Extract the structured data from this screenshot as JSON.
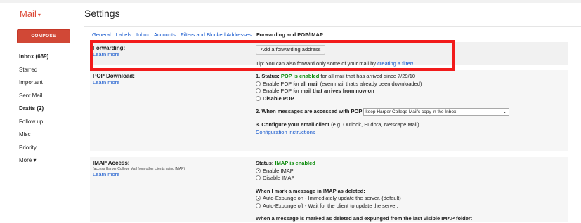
{
  "app": {
    "title": "Mail",
    "caret": "▾"
  },
  "page": {
    "title": "Settings"
  },
  "compose": {
    "label": "COMPOSE"
  },
  "sidebar": {
    "items": [
      {
        "label": "Inbox (669)"
      },
      {
        "label": "Starred"
      },
      {
        "label": "Important"
      },
      {
        "label": "Sent Mail"
      },
      {
        "label": "Drafts (2)"
      },
      {
        "label": "Follow up"
      },
      {
        "label": "Misc"
      },
      {
        "label": "Priority"
      },
      {
        "label": "More ▾"
      }
    ]
  },
  "tabs": [
    {
      "label": "General"
    },
    {
      "label": "Labels"
    },
    {
      "label": "Inbox"
    },
    {
      "label": "Accounts"
    },
    {
      "label": "Filters and Blocked Addresses"
    },
    {
      "label": "Forwarding and POP/IMAP"
    }
  ],
  "forwarding": {
    "title": "Forwarding:",
    "learn_more": "Learn more",
    "add_button": "Add a forwarding address",
    "tip_text": "Tip: You can also forward only some of your mail by ",
    "tip_link": "creating a filter!"
  },
  "pop": {
    "title": "POP Download:",
    "learn_more": "Learn more",
    "status_prefix": "1. Status: ",
    "status_value": "POP is enabled",
    "status_suffix": " for all mail that has arrived since 7/29/10",
    "opt1_a": "Enable POP for ",
    "opt1_b": "all mail",
    "opt1_c": " (even mail that's already been downloaded)",
    "opt2_a": "Enable POP for ",
    "opt2_b": "mail that arrives from now on",
    "opt3": "Disable POP",
    "when_label": "2. When messages are accessed with POP",
    "when_value": "keep Harper College Mail's copy in the Inbox",
    "configure_label": "3. Configure your email client",
    "configure_suffix": " (e.g. Outlook, Eudora, Netscape Mail)",
    "instructions": "Configuration instructions"
  },
  "imap": {
    "title": "IMAP Access:",
    "note": "(access Harper College Mail from other clients using IMAP)",
    "learn_more": "Learn more",
    "status_prefix": "Status: ",
    "status_value": "IMAP is enabled",
    "enable": "Enable IMAP",
    "disable": "Disable IMAP",
    "deleted_label": "When I mark a message in IMAP as deleted:",
    "expunge_on": "Auto-Expunge on - Immediately update the server. (default)",
    "expunge_off": "Auto-Expunge off - Wait for the client to update the server.",
    "expunged_label": "When a message is marked as deleted and expunged from the last visible IMAP folder:"
  }
}
